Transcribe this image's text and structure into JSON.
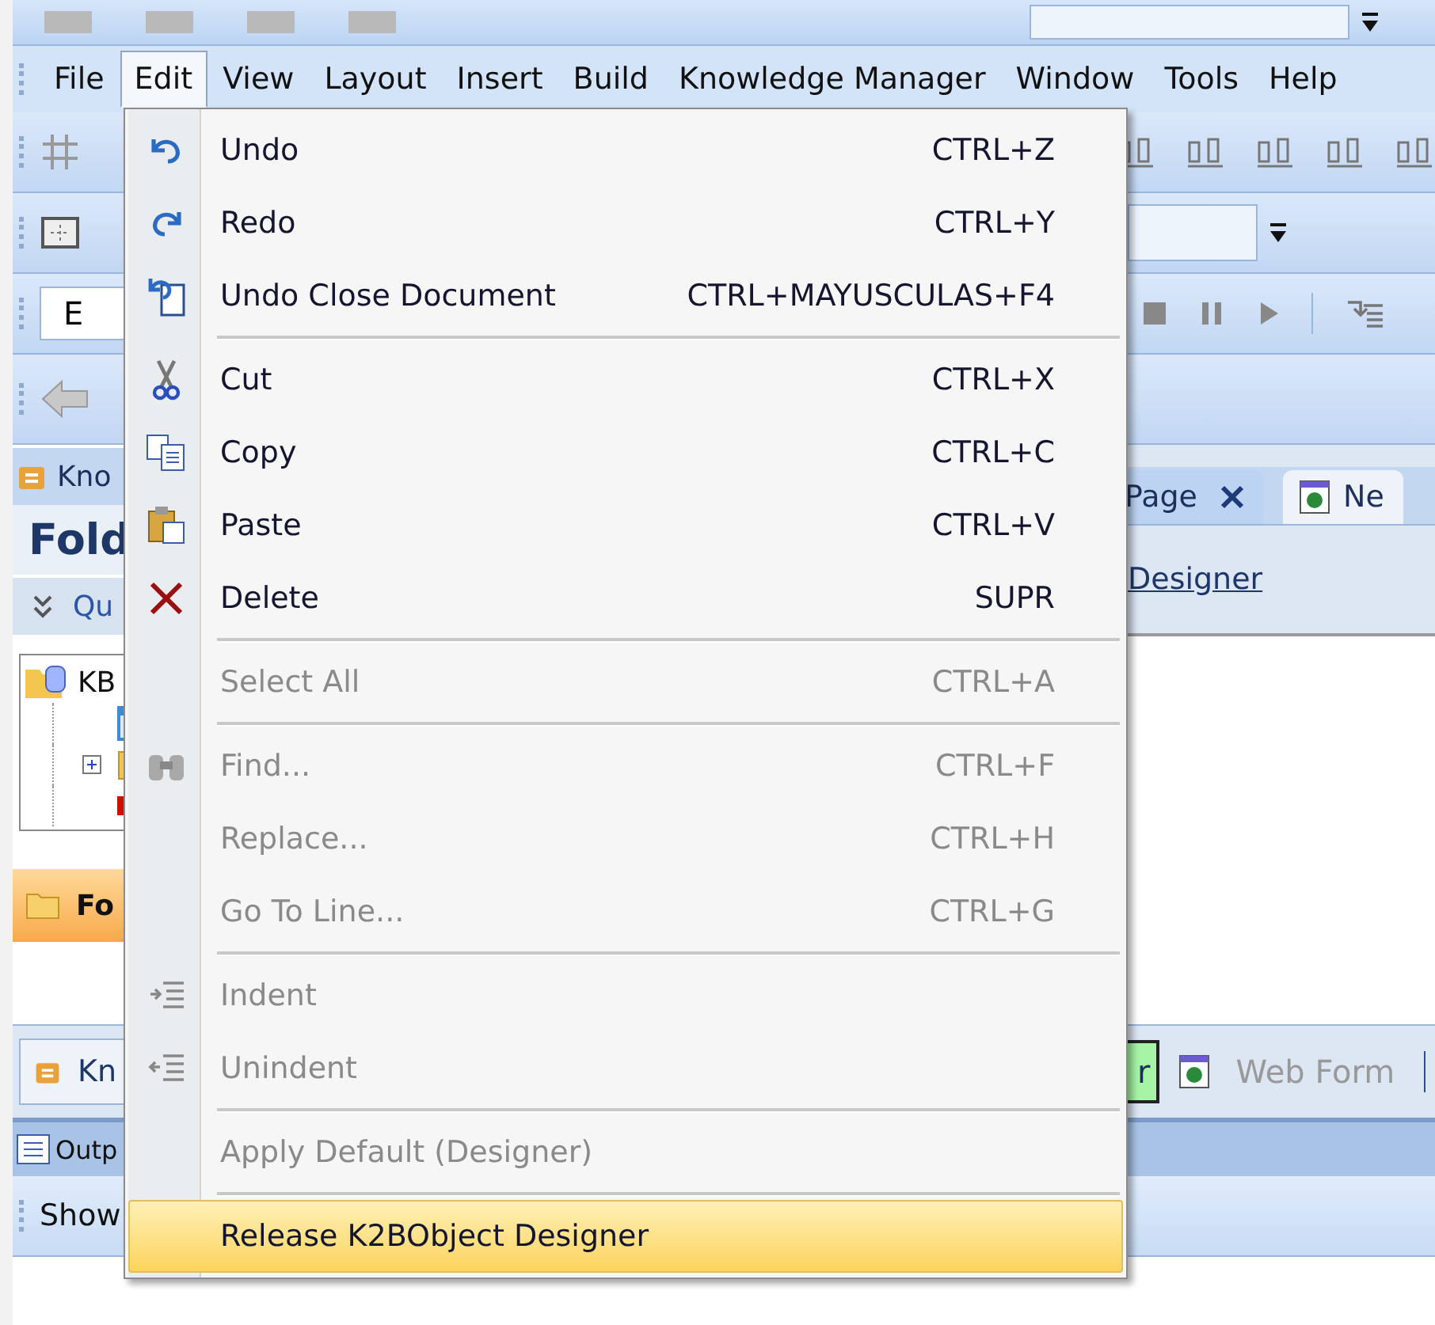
{
  "menu_bar": [
    {
      "label": "File",
      "selected": false
    },
    {
      "label": "Edit",
      "selected": true
    },
    {
      "label": "View",
      "selected": false
    },
    {
      "label": "Layout",
      "selected": false
    },
    {
      "label": "Insert",
      "selected": false
    },
    {
      "label": "Build",
      "selected": false
    },
    {
      "label": "Knowledge Manager",
      "selected": false
    },
    {
      "label": "Window",
      "selected": false
    },
    {
      "label": "Tools",
      "selected": false
    },
    {
      "label": "Help",
      "selected": false
    }
  ],
  "toolbar_field": {
    "value": "E"
  },
  "doc_tabs": [
    {
      "label": "Page",
      "selected": false
    },
    {
      "label": "Ne",
      "selected": true
    }
  ],
  "designer_link": "Designer",
  "left_panel": {
    "header": "Kno",
    "title": "Fold",
    "query": "Qu",
    "tree_root": "KB",
    "folder_bar": "Fo",
    "bottom_tab": "Kn"
  },
  "bottom_tabs": [
    {
      "label": "r",
      "color": "#a6f5a6"
    },
    {
      "label": "Web Form",
      "color": "#dde6f3"
    }
  ],
  "output": {
    "header": "Outp",
    "toolbar_button": "Show"
  },
  "edit_menu": {
    "groups": [
      [
        {
          "label": "Undo",
          "shortcut": "CTRL+Z",
          "disabled": false,
          "selected": false
        },
        {
          "label": "Redo",
          "shortcut": "CTRL+Y",
          "disabled": false,
          "selected": false
        },
        {
          "label": "Undo Close Document",
          "shortcut": "CTRL+MAYUSCULAS+F4",
          "disabled": false,
          "selected": false
        }
      ],
      [
        {
          "label": "Cut",
          "shortcut": "CTRL+X",
          "disabled": false,
          "selected": false
        },
        {
          "label": "Copy",
          "shortcut": "CTRL+C",
          "disabled": false,
          "selected": false
        },
        {
          "label": "Paste",
          "shortcut": "CTRL+V",
          "disabled": false,
          "selected": false
        },
        {
          "label": "Delete",
          "shortcut": "SUPR",
          "disabled": false,
          "selected": false
        }
      ],
      [
        {
          "label": "Select All",
          "shortcut": "CTRL+A",
          "disabled": true,
          "selected": false
        }
      ],
      [
        {
          "label": "Find...",
          "shortcut": "CTRL+F",
          "disabled": true,
          "selected": false
        },
        {
          "label": "Replace...",
          "shortcut": "CTRL+H",
          "disabled": true,
          "selected": false
        },
        {
          "label": "Go To Line...",
          "shortcut": "CTRL+G",
          "disabled": true,
          "selected": false
        }
      ],
      [
        {
          "label": "Indent",
          "disabled": true,
          "selected": false
        },
        {
          "label": "Unindent",
          "disabled": true,
          "selected": false
        }
      ],
      [
        {
          "label": "Apply Default (Designer)",
          "disabled": true,
          "selected": false
        }
      ],
      [
        {
          "label": "Release K2BObject Designer",
          "disabled": false,
          "selected": true
        }
      ]
    ]
  }
}
